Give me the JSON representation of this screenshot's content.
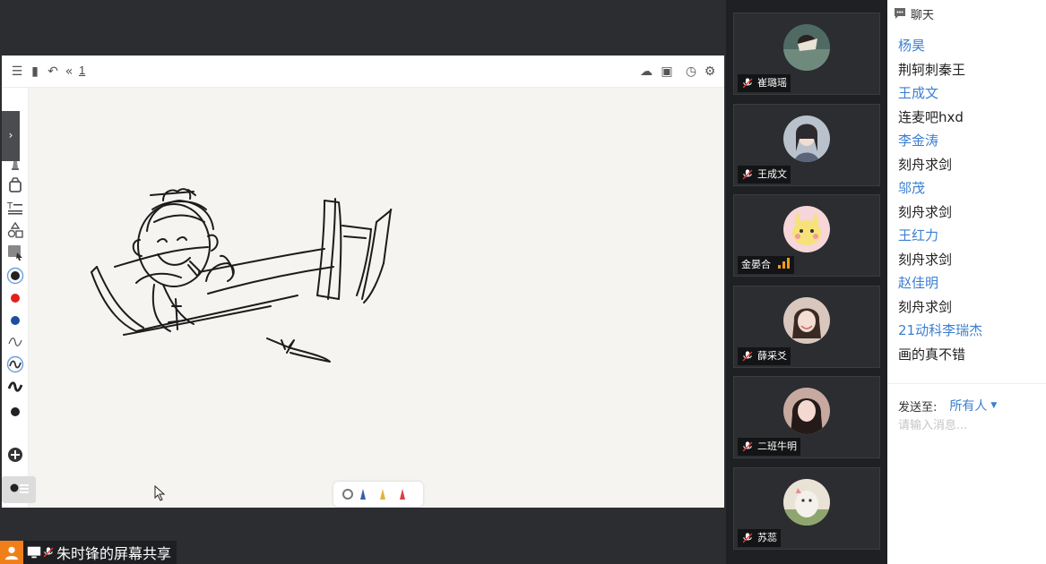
{
  "whiteboard": {
    "page_number": "1",
    "colors": {
      "black": "#222222",
      "red": "#e02020",
      "blue": "#1c4f9c"
    }
  },
  "share_label": "朱时锋的屏幕共享",
  "participants": [
    {
      "name": "崔璐瑶",
      "avatar_bg": "#4e6a63"
    },
    {
      "name": "王成文",
      "avatar_bg": "#b9c2cc"
    },
    {
      "name": "金晏合",
      "avatar_bg": "#f6d6d8"
    },
    {
      "name": "薛采爻",
      "avatar_bg": "#d9c7be"
    },
    {
      "name": "二班牛明",
      "avatar_bg": "#c7a9a0"
    },
    {
      "name": "苏蕊",
      "avatar_bg": "#e9e3d6"
    }
  ],
  "chat": {
    "title": "聊天",
    "messages": [
      {
        "type": "name",
        "text": "杨昊"
      },
      {
        "type": "text",
        "text": "荆轲刺秦王"
      },
      {
        "type": "name",
        "text": "王成文"
      },
      {
        "type": "text",
        "text": "连麦吧hxd"
      },
      {
        "type": "name",
        "text": "李金涛"
      },
      {
        "type": "text",
        "text": "刻舟求剑"
      },
      {
        "type": "name",
        "text": "邬茂"
      },
      {
        "type": "text",
        "text": "刻舟求剑"
      },
      {
        "type": "name",
        "text": "王红力"
      },
      {
        "type": "text",
        "text": "刻舟求剑"
      },
      {
        "type": "name",
        "text": "赵佳明"
      },
      {
        "type": "text",
        "text": "刻舟求剑"
      },
      {
        "type": "name",
        "text": "21动科李瑞杰"
      },
      {
        "type": "text",
        "text": "画的真不错"
      }
    ],
    "send_to_label": "发送至:",
    "send_target": "所有人",
    "input_placeholder": "请输入消息..."
  }
}
